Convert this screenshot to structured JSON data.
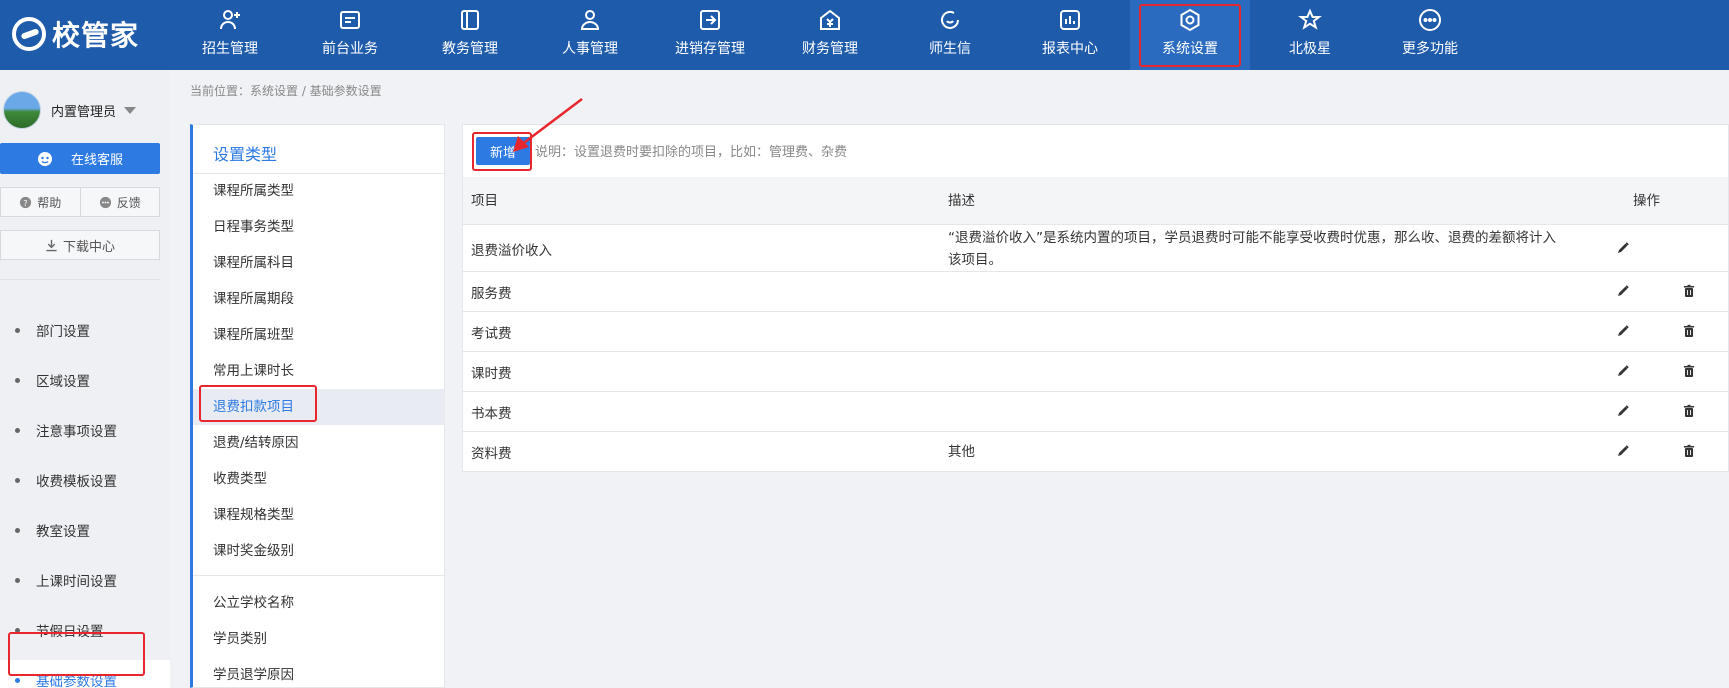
{
  "brand": {
    "logo_text": "校管家"
  },
  "nav": [
    {
      "label": "招生管理",
      "icon": "person-add-icon"
    },
    {
      "label": "前台业务",
      "icon": "message-board-icon"
    },
    {
      "label": "教务管理",
      "icon": "book-icon"
    },
    {
      "label": "人事管理",
      "icon": "person-icon"
    },
    {
      "label": "进销存管理",
      "icon": "inventory-icon"
    },
    {
      "label": "财务管理",
      "icon": "finance-icon"
    },
    {
      "label": "师生信",
      "icon": "chat-icon"
    },
    {
      "label": "报表中心",
      "icon": "report-icon"
    },
    {
      "label": "系统设置",
      "icon": "settings-icon",
      "active": true
    },
    {
      "label": "北极星",
      "icon": "star-icon"
    },
    {
      "label": "更多功能",
      "icon": "more-icon"
    }
  ],
  "sidebar": {
    "user_name": "内置管理员",
    "service_label": "在线客服",
    "help_label": "帮助",
    "feedback_label": "反馈",
    "download_label": "下载中心",
    "menu": [
      {
        "label": "部门设置"
      },
      {
        "label": "区域设置"
      },
      {
        "label": "注意事项设置"
      },
      {
        "label": "收费模板设置"
      },
      {
        "label": "教室设置"
      },
      {
        "label": "上课时间设置"
      },
      {
        "label": "节假日设置"
      },
      {
        "label": "基础参数设置",
        "active": true
      }
    ]
  },
  "breadcrumb": "当前位置：系统设置 / 基础参数设置",
  "categories": {
    "title": "设置类型",
    "items": [
      "课程所属类型",
      "日程事务类型",
      "课程所属科目",
      "课程所属期段",
      "课程所属班型",
      "常用上课时长",
      "退费扣款项目",
      "退费/结转原因",
      "收费类型",
      "课程规格类型",
      "课时奖金级别"
    ],
    "active_index": 6,
    "items2": [
      "公立学校名称",
      "学员类别",
      "学员退学原因"
    ]
  },
  "main": {
    "add_label": "新增",
    "note": "说明：设置退费时要扣除的项目，比如：管理费、杂费",
    "columns": {
      "item": "项目",
      "desc": "描述",
      "ops": "操作"
    },
    "rows": [
      {
        "name": "退费溢价收入",
        "desc": "“退费溢价收入”是系统内置的项目，学员退费时可能不能享受收费时优惠，那么收、退费的差额将计入该项目。",
        "deletable": false
      },
      {
        "name": "服务费",
        "desc": "",
        "deletable": true
      },
      {
        "name": "考试费",
        "desc": "",
        "deletable": true
      },
      {
        "name": "课时费",
        "desc": "",
        "deletable": true
      },
      {
        "name": "书本费",
        "desc": "",
        "deletable": true
      },
      {
        "name": "资料费",
        "desc": "其他",
        "deletable": true
      }
    ]
  },
  "colors": {
    "nav_bg": "#1f5bab",
    "accent": "#2d7ae3",
    "highlight": "#e8262d"
  }
}
